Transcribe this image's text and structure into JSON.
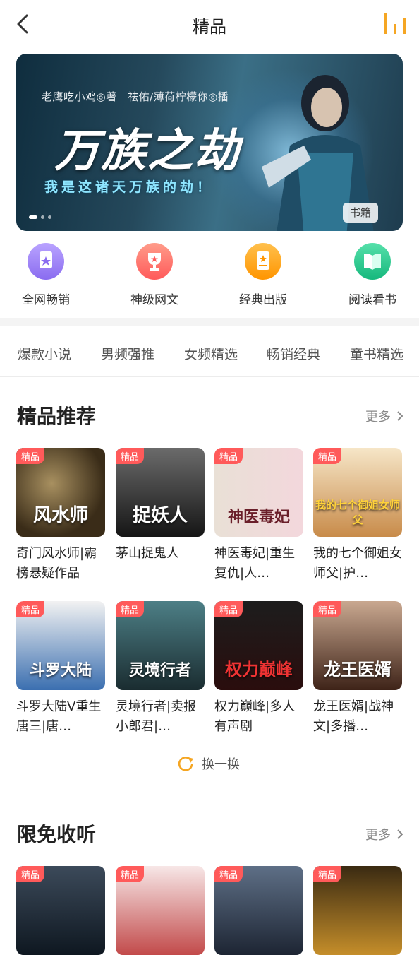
{
  "header": {
    "title": "精品"
  },
  "banner": {
    "authors": "老鹰吃小鸡◎著　祛佑/薄荷柠檬你◎播",
    "title": "万族之劫",
    "subtitle": "我是这诸天万族的劫！",
    "badge": "书籍",
    "active_dot": 0
  },
  "quick_nav": [
    {
      "label": "全网畅销",
      "icon": "medal-icon",
      "color": "#9b7df2"
    },
    {
      "label": "神级网文",
      "icon": "trophy-icon",
      "color": "#ff6b6b"
    },
    {
      "label": "经典出版",
      "icon": "book-star-icon",
      "color": "#ffa21f"
    },
    {
      "label": "阅读看书",
      "icon": "open-book-icon",
      "color": "#24c48b"
    }
  ],
  "tabs": [
    "爆款小说",
    "男频强推",
    "女频精选",
    "畅销经典",
    "童书精选"
  ],
  "section_recommend": {
    "title": "精品推荐",
    "more": "更多",
    "books": [
      {
        "tag": "精品",
        "cover_text": "风水师",
        "title": "奇门风水师|霸榜悬疑作品"
      },
      {
        "tag": "精品",
        "cover_text": "捉妖人",
        "title": "茅山捉鬼人"
      },
      {
        "tag": "精品",
        "cover_text": "神医毒妃",
        "title": "神医毒妃|重生复仇|人…"
      },
      {
        "tag": "精品",
        "cover_text": "我的七个御姐女师父",
        "title": "我的七个御姐女师父|护…"
      },
      {
        "tag": "精品",
        "cover_text": "斗罗大陆",
        "title": "斗罗大陆V重生唐三|唐…"
      },
      {
        "tag": "精品",
        "cover_text": "灵境行者",
        "title": "灵境行者|卖报小郎君|…"
      },
      {
        "tag": "精品",
        "cover_text": "权力巅峰",
        "title": "权力巅峰|多人有声剧"
      },
      {
        "tag": "精品",
        "cover_text": "龙王医婿",
        "title": "龙王医婿|战神文|多播…"
      }
    ],
    "refresh": "换一换"
  },
  "section_free": {
    "title": "限免收听",
    "more": "更多",
    "books": [
      {
        "tag": "精品"
      },
      {
        "tag": "精品"
      },
      {
        "tag": "精品"
      },
      {
        "tag": "精品"
      }
    ]
  },
  "colors": {
    "accent": "#f5a623",
    "tag_red": "#ff5a5a"
  }
}
